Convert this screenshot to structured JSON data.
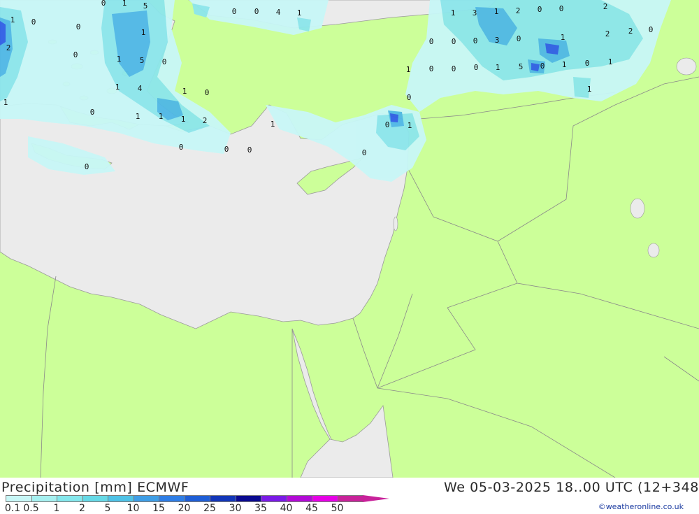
{
  "header": {
    "title_left": "Precipitation [mm] ECMWF",
    "title_right": "We 05-03-2025 18..00 UTC (12+348"
  },
  "credit": "©weatheronline.co.uk",
  "legend": {
    "ticks": [
      "0.1",
      "0.5",
      "1",
      "2",
      "5",
      "10",
      "15",
      "20",
      "25",
      "30",
      "35",
      "40",
      "45",
      "50"
    ],
    "colors": [
      "#c8f7f7",
      "#a6f0f0",
      "#84e7ec",
      "#66d9e6",
      "#4fc2e6",
      "#3f9ee6",
      "#2f7ee6",
      "#1e5ed6",
      "#1236b8",
      "#0a0a90",
      "#7a1ae6",
      "#b20ad6",
      "#e600e6",
      "#c8229a"
    ]
  },
  "map_colors": {
    "land": "#ccff99",
    "sea": "#ebebeb",
    "precip_light": "#c8f7f7",
    "precip_mid": "#8ce6ec",
    "precip_heavy": "#4fb8e6",
    "precip_max": "#2f5ee6"
  },
  "values": [
    {
      "v": "0"
    },
    {
      "v": "1"
    },
    {
      "v": "5"
    },
    {
      "v": "1"
    },
    {
      "v": "0"
    },
    {
      "v": "0"
    },
    {
      "v": "2"
    },
    {
      "v": "0"
    },
    {
      "v": "1"
    },
    {
      "v": "1"
    },
    {
      "v": "5"
    },
    {
      "v": "0"
    },
    {
      "v": "1"
    },
    {
      "v": "4"
    },
    {
      "v": "1"
    },
    {
      "v": "1"
    },
    {
      "v": "0"
    },
    {
      "v": "0"
    },
    {
      "v": "1"
    },
    {
      "v": "1"
    },
    {
      "v": "1"
    },
    {
      "v": "2"
    },
    {
      "v": "0"
    },
    {
      "v": "0"
    },
    {
      "v": "0"
    },
    {
      "v": "0"
    },
    {
      "v": "0"
    },
    {
      "v": "0"
    },
    {
      "v": "4"
    },
    {
      "v": "1"
    },
    {
      "v": "1"
    },
    {
      "v": "1"
    },
    {
      "v": "3"
    },
    {
      "v": "1"
    },
    {
      "v": "2"
    },
    {
      "v": "0"
    },
    {
      "v": "0"
    },
    {
      "v": "2"
    },
    {
      "v": "0"
    },
    {
      "v": "0"
    },
    {
      "v": "0"
    },
    {
      "v": "3"
    },
    {
      "v": "0"
    },
    {
      "v": "1"
    },
    {
      "v": "2"
    },
    {
      "v": "2"
    },
    {
      "v": "0"
    },
    {
      "v": "1"
    },
    {
      "v": "0"
    },
    {
      "v": "0"
    },
    {
      "v": "0"
    },
    {
      "v": "1"
    },
    {
      "v": "5"
    },
    {
      "v": "0"
    },
    {
      "v": "1"
    },
    {
      "v": "0"
    },
    {
      "v": "1"
    },
    {
      "v": "1"
    },
    {
      "v": "0"
    },
    {
      "v": "0"
    },
    {
      "v": "1"
    },
    {
      "v": "0"
    }
  ]
}
